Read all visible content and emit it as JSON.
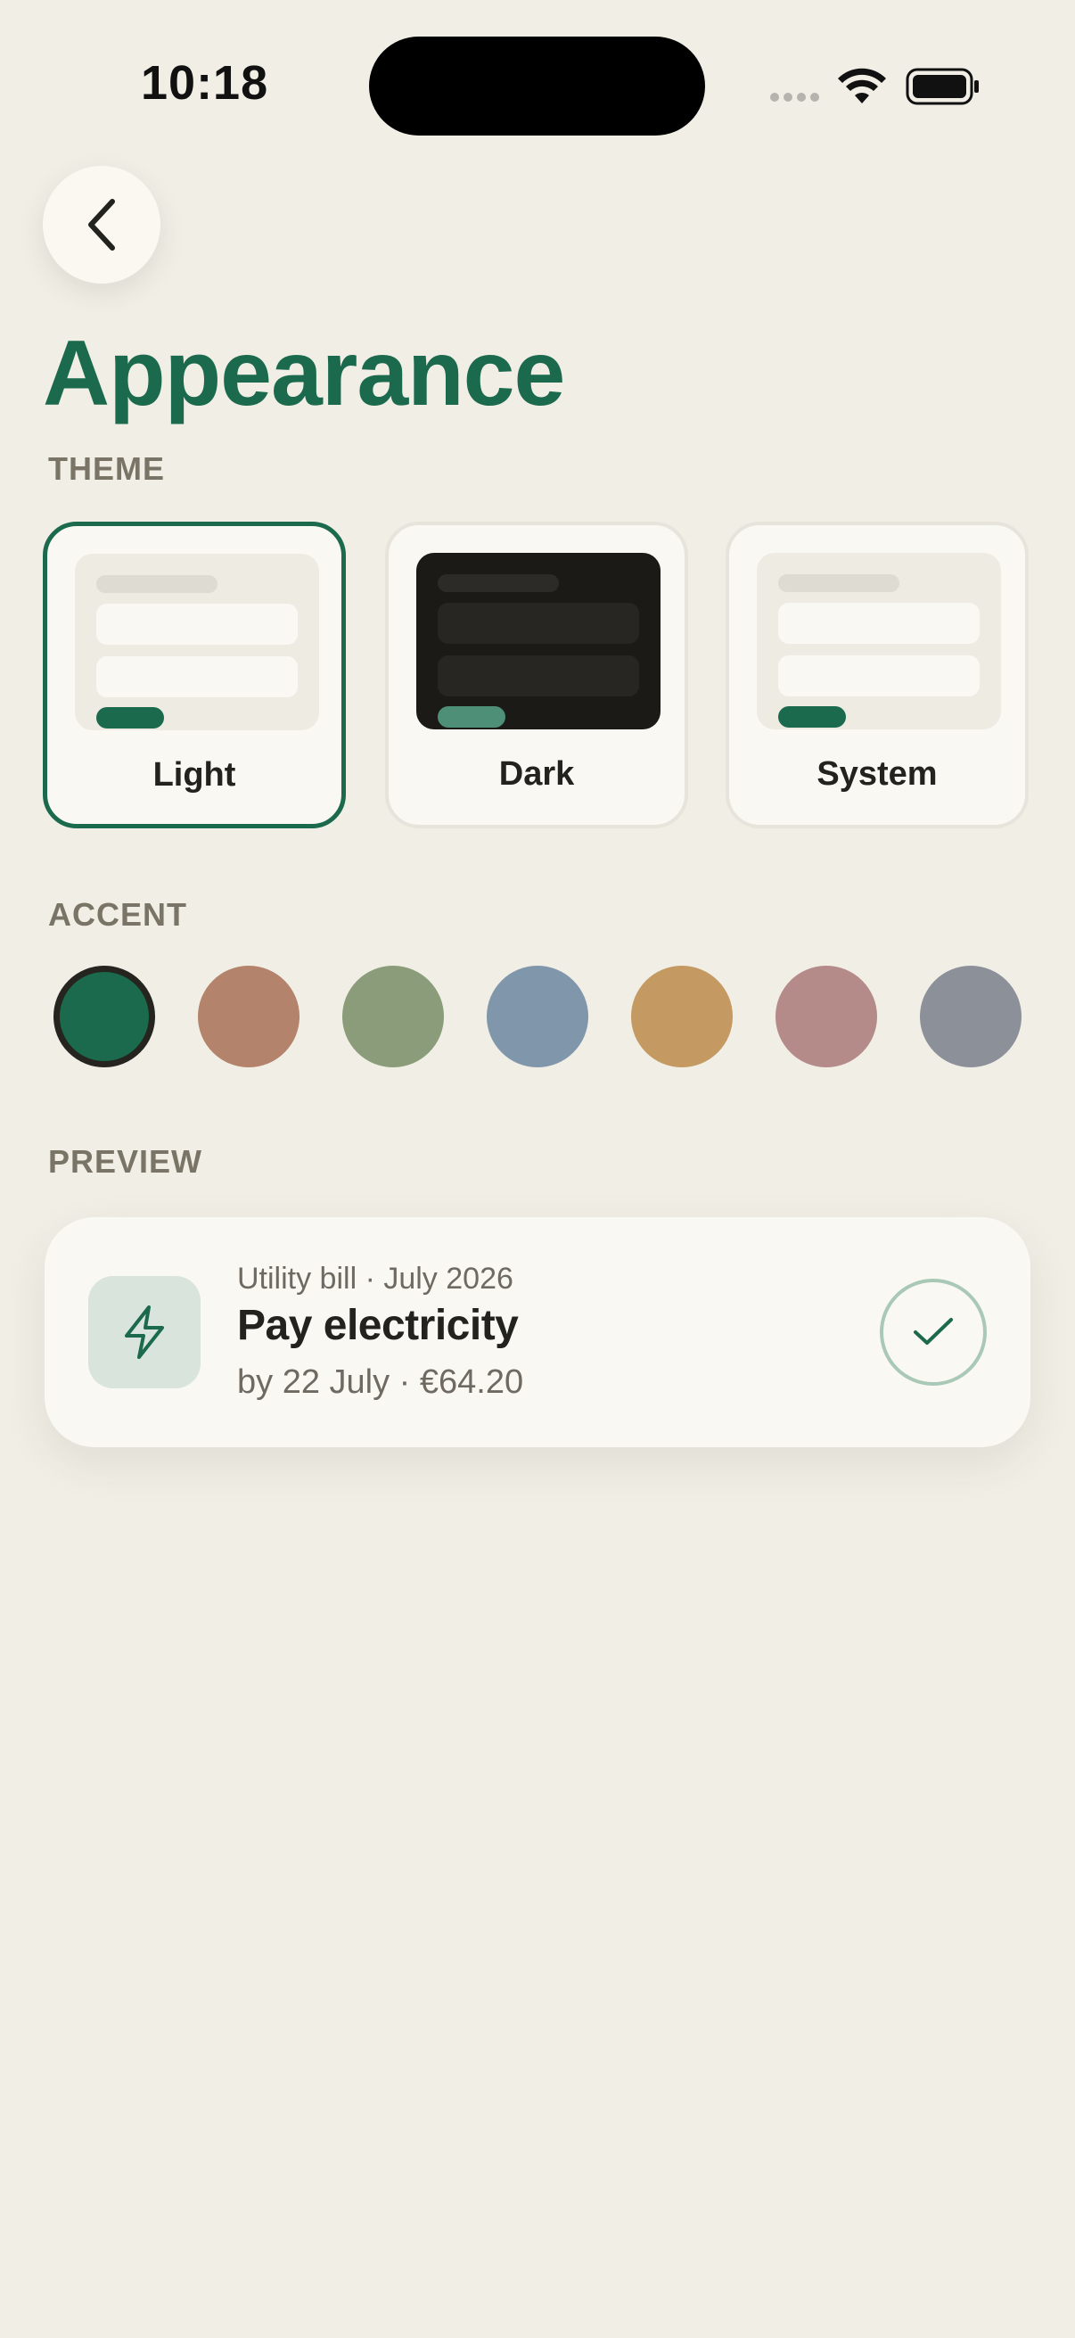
{
  "status_bar": {
    "time": "10:18"
  },
  "header": {
    "title": "Appearance"
  },
  "sections": {
    "theme": "THEME",
    "accent": "ACCENT",
    "preview": "PREVIEW"
  },
  "themes": [
    {
      "label": "Light",
      "selected": true
    },
    {
      "label": "Dark",
      "selected": false
    },
    {
      "label": "System",
      "selected": false
    }
  ],
  "accents": [
    {
      "name": "green",
      "color": "#1b6a4d",
      "selected": true
    },
    {
      "name": "terracotta",
      "color": "#b3836b",
      "selected": false
    },
    {
      "name": "sage",
      "color": "#8a9c7a",
      "selected": false
    },
    {
      "name": "slate-blue",
      "color": "#7f96ab",
      "selected": false
    },
    {
      "name": "ochre",
      "color": "#c49a62",
      "selected": false
    },
    {
      "name": "rose",
      "color": "#b48b88",
      "selected": false
    },
    {
      "name": "gray",
      "color": "#8c9199",
      "selected": false
    }
  ],
  "preview": {
    "subtitle": "Utility bill · July 2026",
    "title": "Pay electricity",
    "meta": "by 22 July · €64.20",
    "icon": "lightning-icon"
  },
  "colors": {
    "accent": "#1b6a4d",
    "background": "#f1eee6",
    "card": "#faf8f3"
  }
}
